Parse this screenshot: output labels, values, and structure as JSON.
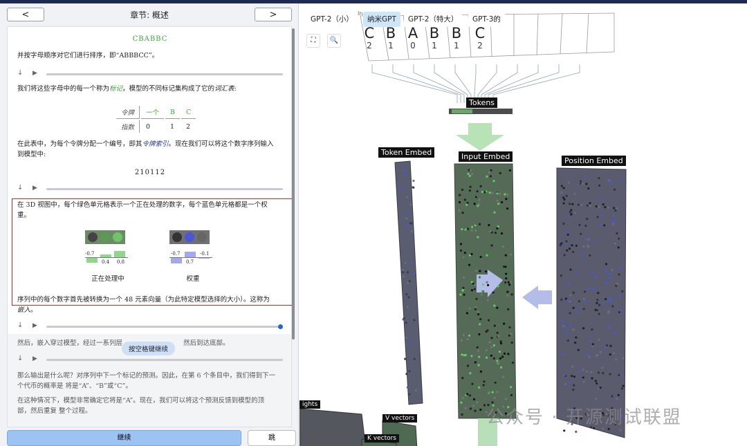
{
  "header": {
    "prev": "<",
    "next": ">",
    "chapter": "章节: 概述"
  },
  "content": {
    "seq_letters": "CBABBC",
    "p_sorted": "并按字母顺序对它们进行排序，即“ABBBCC”。",
    "p_tokens_pre": "我们将这些字母中的每一个称为",
    "p_tokens_term": "标记",
    "p_tokens_mid": "，模型的不同标记集构成了它的",
    "p_tokens_term2": "词汇表",
    "p_tokens_post": ":",
    "vocab": {
      "row1_label": "令牌",
      "row1": [
        "一个",
        "B",
        "C"
      ],
      "row2_label": "指数",
      "row2": [
        "0",
        "1",
        "2"
      ]
    },
    "p_index_1": "在此表中，为每个令牌分配一个编号，即其",
    "p_index_term": "令牌索引",
    "p_index_2": "。现在我们可以将这个数字序列输入",
    "p_index_3": "到模型中:",
    "seq_numbers": "210112",
    "p_3d_1": "在 3D 视图中，每个绿色单元格表示一个正在处理的数字，每个蓝色单元格都是一个权",
    "p_3d_2": "重。",
    "proc_vals": [
      "-0.7",
      "0.4",
      "0.8"
    ],
    "weight_vals": [
      "-0.7",
      "0.7",
      "-0.1"
    ],
    "proc_label": "正在处理中",
    "weight_label": "权重",
    "p_embed_1": "序列中的每个数字首先被转换为一个 48 元素向量（为此特定模型选择的大小）。这称为",
    "p_embed_term": "嵌入",
    "p_embed_2": "。",
    "p_then_a": "然后，嵌入穿过模型，经过一系列层",
    "p_then_b": "然后到达底部。",
    "tip": "按空格键继续",
    "p_output_1": "那么输出是什么呢？对序列中下一个标记的预测。因此，在第 6 个条目中，我们得到下一",
    "p_output_2": "个代币的概率是 将是“A”、“B”或“C”。",
    "p_final_1": "在这种情况下，模型非常确定它将是“A”。现在，我们可以将这个预测反馈到模型的顶",
    "p_final_2": "部，然后重复 整个过程。"
  },
  "players": [
    {
      "down": "↓",
      "play": "▶",
      "progress": 0.0
    },
    {
      "down": "↓",
      "play": "▶",
      "progress": 0.0
    },
    {
      "down": "↓",
      "play": "▶",
      "progress": 1.0
    },
    {
      "down": "↓",
      "play": "▶",
      "progress": 0.0
    }
  ],
  "footer": {
    "continue": "继续",
    "skip": "跳"
  },
  "model_tabs": [
    "GPT-2（小）",
    "纳米GPT",
    "GPT-2（特大）",
    "GPT-3的"
  ],
  "model_tab_hint": "In",
  "tools": {
    "fullscreen": "⛶",
    "search": "🔍"
  },
  "tokens": [
    {
      "char": "C",
      "index": "2"
    },
    {
      "char": "B",
      "index": "1"
    },
    {
      "char": "A",
      "index": "0"
    },
    {
      "char": "B",
      "index": "1"
    },
    {
      "char": "B",
      "index": "1"
    },
    {
      "char": "C",
      "index": "2"
    }
  ],
  "labels": {
    "tokens": "Tokens",
    "token_embed": "Token Embed",
    "input_embed": "Input Embed",
    "position_embed": "Position Embed",
    "weights": "ights",
    "v_vectors": "V vectors",
    "k_vectors": "K vectors"
  },
  "watermark": "公众号 · 开源测试联盟",
  "colors": {
    "accent_green": "#3aa63a",
    "weight_blue": "#4a55d8",
    "highlight": "#d22222"
  }
}
